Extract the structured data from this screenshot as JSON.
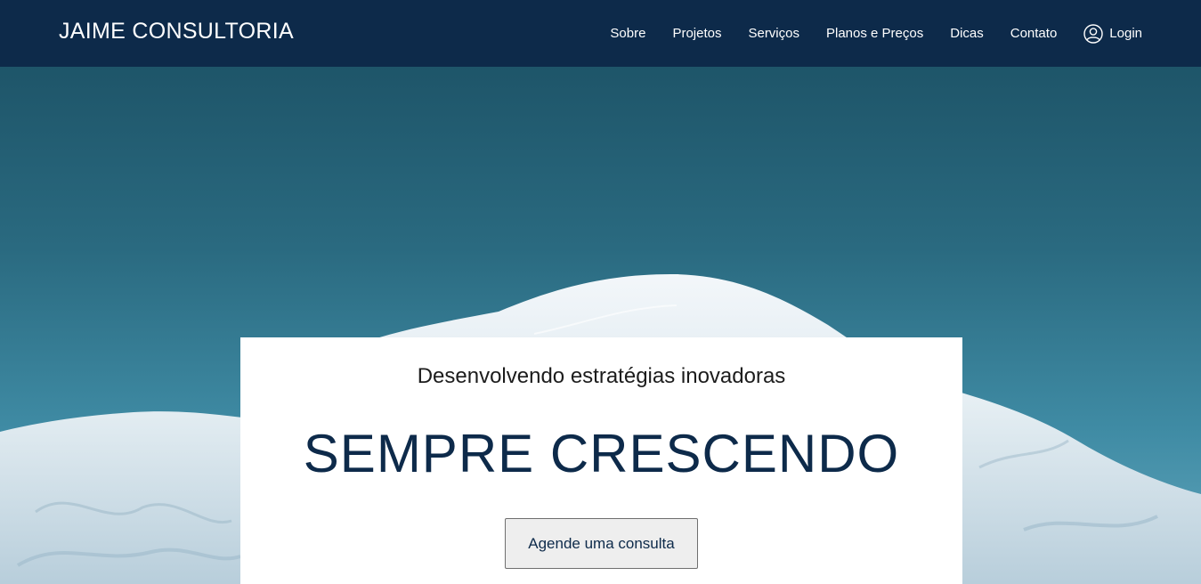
{
  "header": {
    "brand": "JAIME CONSULTORIA",
    "nav": [
      {
        "label": "Sobre"
      },
      {
        "label": "Projetos"
      },
      {
        "label": "Serviços"
      },
      {
        "label": "Planos e Preços"
      },
      {
        "label": "Dicas"
      },
      {
        "label": "Contato"
      }
    ],
    "login_label": "Login",
    "login_icon": "user-circle-icon",
    "background_color": "#0d2a4a"
  },
  "hero": {
    "subtitle": "Desenvolvendo estratégias inovadoras",
    "headline": "SEMPRE CRESCENDO",
    "cta_label": "Agende uma consulta",
    "background_image": "snowy-mountain-peak"
  },
  "colors": {
    "accent": "#0d2a4a",
    "sky": "#2b6a80"
  }
}
